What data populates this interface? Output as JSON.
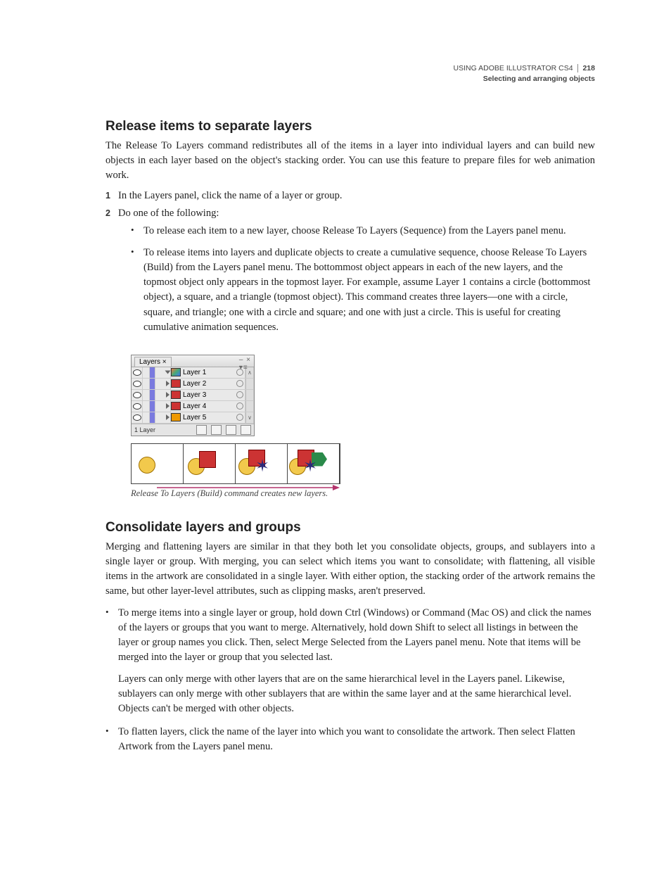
{
  "header": {
    "title": "USING ADOBE ILLUSTRATOR CS4",
    "subtitle": "Selecting and arranging objects",
    "page": "218"
  },
  "section1": {
    "heading": "Release items to separate layers",
    "intro": "The Release To Layers command redistributes all of the items in a layer into individual layers and can build new objects in each layer based on the object's stacking order. You can use this feature to prepare files for web animation work.",
    "step1": "In the Layers panel, click the name of a layer or group.",
    "step2": "Do one of the following:",
    "bullet1": "To release each item to a new layer, choose Release To Layers (Sequence) from the Layers panel menu.",
    "bullet2": "To release items into layers and duplicate objects to create a cumulative sequence, choose Release To Layers (Build) from the Layers panel menu. The bottommost object appears in each of the new layers, and the topmost object only appears in the topmost layer. For example, assume Layer 1 contains a circle (bottommost object), a square, and a triangle (topmost object). This command creates three layers—one with a circle, square, and triangle; one with a circle and square; and one with just a circle. This is useful for creating cumulative animation sequences."
  },
  "panel": {
    "tab": "Layers",
    "rows": [
      {
        "name": "Layer 1"
      },
      {
        "name": "Layer 2"
      },
      {
        "name": "Layer 3"
      },
      {
        "name": "Layer 4"
      },
      {
        "name": "Layer 5"
      }
    ],
    "footer": "1 Layer"
  },
  "caption1": "Release To Layers (Build) command creates new layers.",
  "section2": {
    "heading": "Consolidate layers and groups",
    "intro": "Merging and flattening layers are similar in that they both let you consolidate objects, groups, and sublayers into a single layer or group. With merging, you can select which items you want to consolidate; with flattening, all visible items in the artwork are consolidated in a single layer. With either option, the stacking order of the artwork remains the same, but other layer-level attributes, such as clipping masks, aren't preserved.",
    "bullet1a": "To merge items into a single layer or group, hold down Ctrl (Windows) or Command (Mac OS) and click the names of the layers or groups that you want to merge. Alternatively, hold down Shift to select all listings in between the layer or group names you click. Then, select Merge Selected from the Layers panel menu. Note that items will be merged into the layer or group that you selected last.",
    "bullet1b": "Layers can only merge with other layers that are on the same hierarchical level in the Layers panel. Likewise, sublayers can only merge with other sublayers that are within the same layer and at the same hierarchical level. Objects can't be merged with other objects.",
    "bullet2": "To flatten layers, click the name of the layer into which you want to consolidate the artwork. Then select Flatten Artwork from the Layers panel menu."
  }
}
